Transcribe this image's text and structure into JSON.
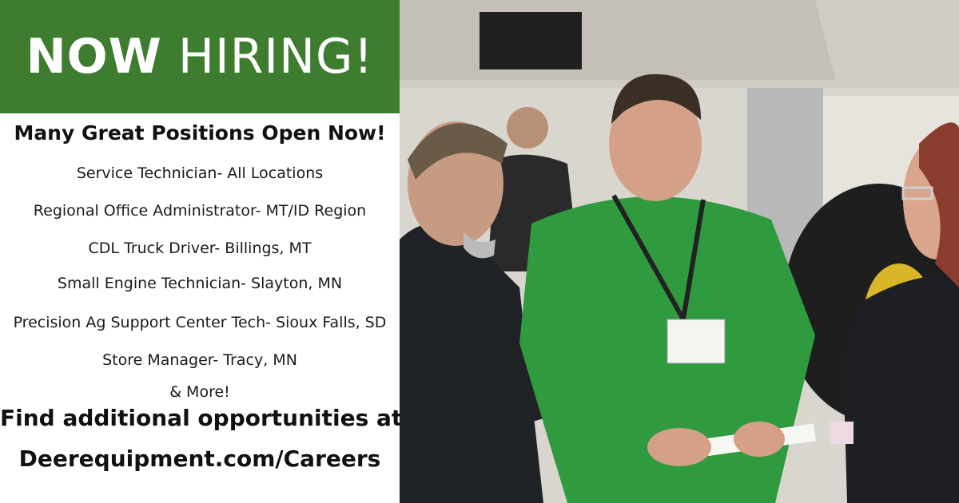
{
  "banner": {
    "headline_bold": "NOW",
    "headline_rest": "HIRING!"
  },
  "subheading": "Many Great Positions Open Now!",
  "positions": [
    "Service Technician- All Locations",
    "Regional Office Administrator- MT/ID Region",
    "CDL Truck Driver- Billings, MT",
    "Small Engine Technician- Slayton, MN",
    "Precision Ag Support Center Tech- Sioux Falls, SD",
    "Store Manager- Tracy, MN"
  ],
  "more": "& More!",
  "cta": {
    "line1": "Find additional opportunities at",
    "line2": "Deerequipment.com/Careers"
  },
  "colors": {
    "banner_green": "#3e7d2f",
    "jacket_green": "#2f9a3e",
    "text": "#111111"
  }
}
